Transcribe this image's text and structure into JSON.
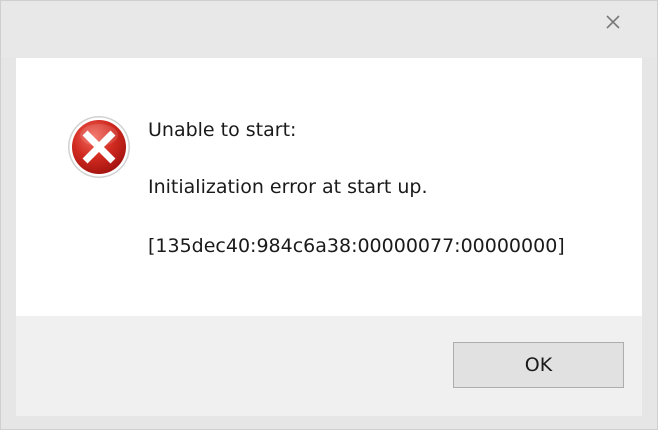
{
  "dialog": {
    "title": "",
    "icon": "error-icon",
    "lines": [
      "Unable to start:",
      "Initialization error at start up.",
      "[135dec40:984c6a38:00000077:00000000]"
    ],
    "ok_label": "OK"
  },
  "colors": {
    "error_red": "#c8201c",
    "content_bg": "#ffffff",
    "footer_bg": "#f0f0f0",
    "chrome_bg": "#e6e6e6"
  }
}
